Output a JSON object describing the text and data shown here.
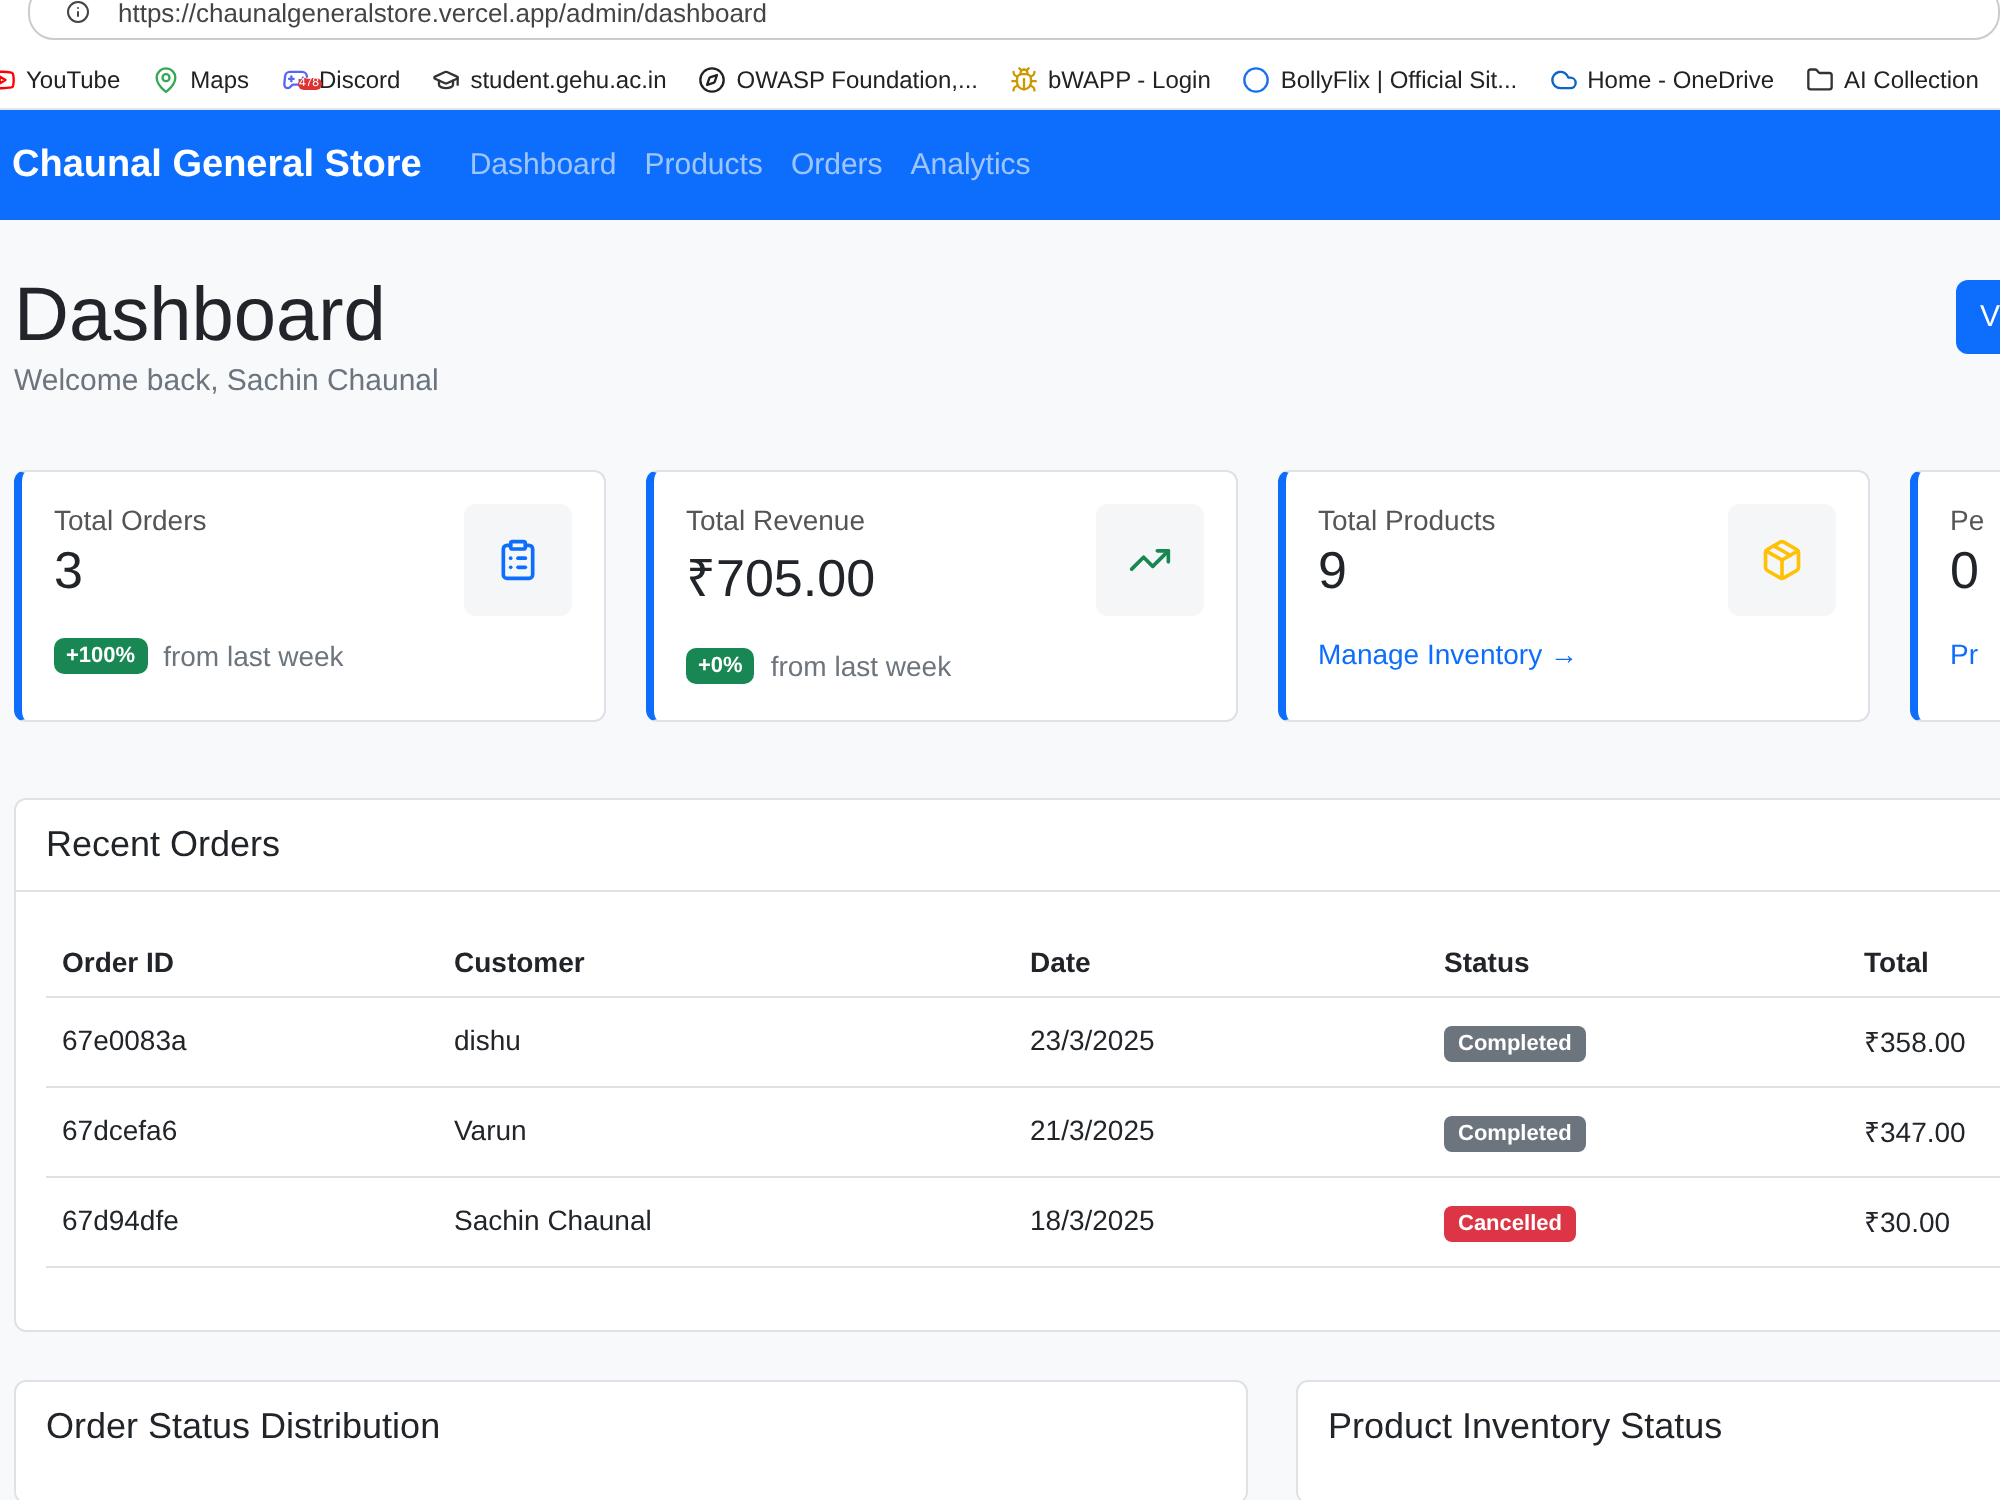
{
  "browser": {
    "url": "https://chaunalgeneralstore.vercel.app/admin/dashboard",
    "bookmarks": [
      {
        "label": "YouTube"
      },
      {
        "label": "Maps"
      },
      {
        "label": "Discord",
        "badge": "478"
      },
      {
        "label": "student.gehu.ac.in"
      },
      {
        "label": "OWASP Foundation,..."
      },
      {
        "label": "bWAPP - Login"
      },
      {
        "label": "BollyFlix | Official Sit..."
      },
      {
        "label": "Home - OneDrive"
      },
      {
        "label": "AI Collection"
      }
    ]
  },
  "navbar": {
    "brand": "Chaunal General Store",
    "links": [
      {
        "label": "Dashboard"
      },
      {
        "label": "Products"
      },
      {
        "label": "Orders"
      },
      {
        "label": "Analytics"
      }
    ]
  },
  "header": {
    "title": "Dashboard",
    "subtitle": "Welcome back, Sachin Chaunal",
    "button": "V"
  },
  "stats": [
    {
      "title": "Total Orders",
      "value": "3",
      "footer": {
        "kind": "change",
        "badge": "+100%",
        "text": "from last week"
      }
    },
    {
      "title": "Total Revenue",
      "value": "₹705.00",
      "footer": {
        "kind": "change",
        "badge": "+0%",
        "text": "from last week"
      }
    },
    {
      "title": "Total Products",
      "value": "9",
      "footer": {
        "kind": "link",
        "text": "Manage Inventory →"
      }
    },
    {
      "title": "Pe",
      "value": "0",
      "footer": {
        "kind": "link",
        "text": "Pr"
      }
    }
  ],
  "recent_orders": {
    "title": "Recent Orders",
    "columns": [
      "Order ID",
      "Customer",
      "Date",
      "Status",
      "Total"
    ],
    "rows": [
      {
        "id": "67e0083a",
        "customer": "dishu",
        "date": "23/3/2025",
        "status": {
          "label": "Completed",
          "kind": "completed"
        },
        "total": "₹358.00"
      },
      {
        "id": "67dcefa6",
        "customer": "Varun",
        "date": "21/3/2025",
        "status": {
          "label": "Completed",
          "kind": "completed"
        },
        "total": "₹347.00"
      },
      {
        "id": "67d94dfe",
        "customer": "Sachin Chaunal",
        "date": "18/3/2025",
        "status": {
          "label": "Cancelled",
          "kind": "cancelled"
        },
        "total": "₹30.00"
      }
    ]
  },
  "panels": [
    {
      "title": "Order Status Distribution"
    },
    {
      "title": "Product Inventory Status"
    }
  ]
}
